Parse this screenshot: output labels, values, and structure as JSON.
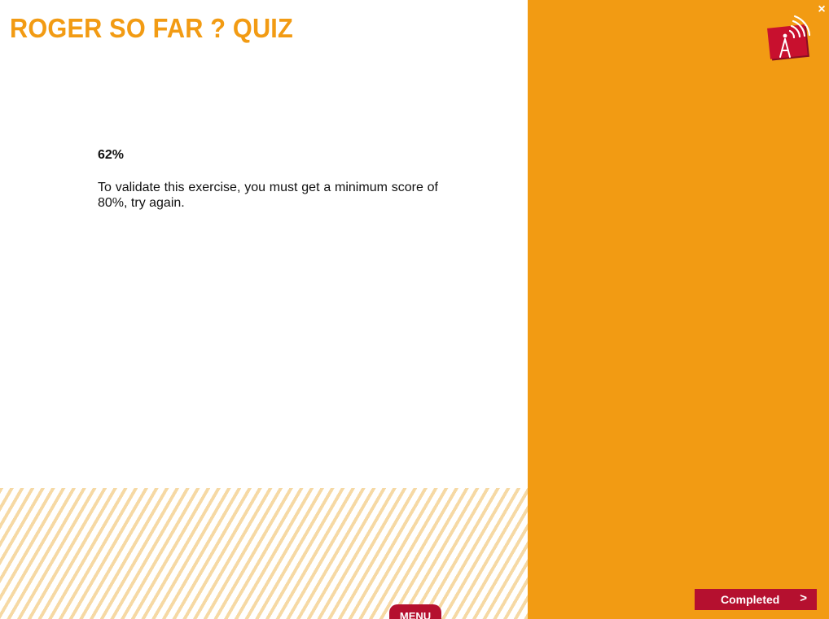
{
  "header": {
    "title": "ROGER SO FAR ? QUIZ"
  },
  "result": {
    "score": "62%",
    "message": "To validate this exercise, you must get a minimum score of 80%, try again."
  },
  "footer": {
    "menu_label": "MENU"
  },
  "sidebar": {
    "close_symbol": "×",
    "logo_icon": "radio-tower-icon",
    "completed_label": "Completed",
    "completed_arrow": ">"
  },
  "colors": {
    "accent_orange": "#f29b13",
    "accent_red": "#b5102f",
    "stripe": "#f6d9a4"
  }
}
